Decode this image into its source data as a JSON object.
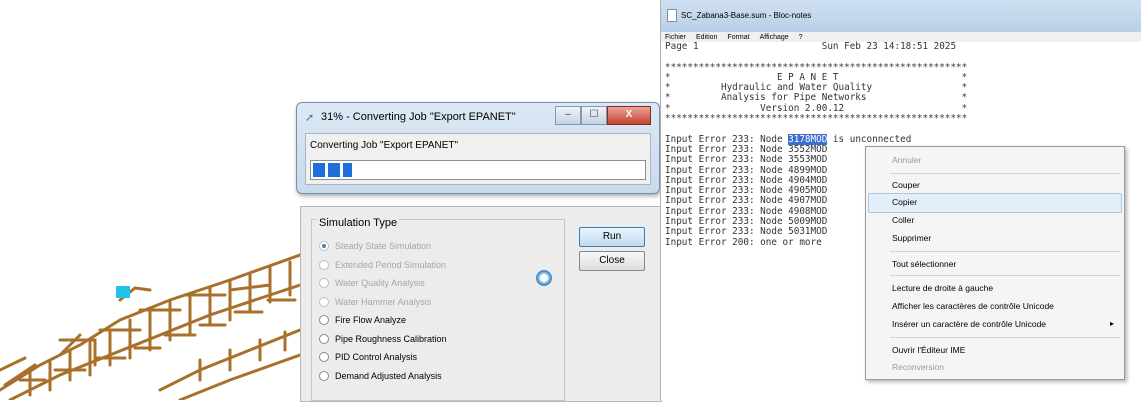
{
  "progress": {
    "title": "31% - Converting Job \"Export EPANET\"",
    "label": "Converting Job \"Export EPANET\"",
    "percent": 31,
    "min_label": "–",
    "max_label": "☐",
    "close_label": "X"
  },
  "simulation": {
    "group_title": "Simulation Type",
    "options": [
      {
        "label": "Steady State Simulation",
        "enabled": false,
        "selected": true
      },
      {
        "label": "Extended Period Simulation",
        "enabled": false,
        "selected": false
      },
      {
        "label": "Water Quality Analysis",
        "enabled": false,
        "selected": false
      },
      {
        "label": "Water Hammer Analysis",
        "enabled": false,
        "selected": false
      },
      {
        "label": "Fire Flow Analyze",
        "enabled": true,
        "selected": false
      },
      {
        "label": "Pipe Roughness Calibration",
        "enabled": true,
        "selected": false
      },
      {
        "label": "PID Control Analysis",
        "enabled": true,
        "selected": false
      },
      {
        "label": "Demand Adjusted Analysis",
        "enabled": true,
        "selected": false
      }
    ],
    "run_label": "Run",
    "close_label": "Close"
  },
  "notepad": {
    "title": "SC_Zabana3-Base.sum - Bloc-notes",
    "menu": [
      "Fichier",
      "Edition",
      "Format",
      "Affichage",
      "?"
    ],
    "lines": [
      "Page 1                      Sun Feb 23 14:18:51 2025",
      "",
      "******************************************************",
      "*                   E P A N E T                      *",
      "*         Hydraulic and Water Quality                *",
      "*         Analysis for Pipe Networks                 *",
      "*                Version 2.00.12                     *",
      "******************************************************",
      "",
      "Input Error 233: Node 3178MOD is unconnected",
      "Input Error 233: Node 3552MOD",
      "Input Error 233: Node 3553MOD",
      "Input Error 233: Node 4899MOD",
      "Input Error 233: Node 4904MOD",
      "Input Error 233: Node 4905MOD",
      "Input Error 233: Node 4907MOD",
      "Input Error 233: Node 4908MOD",
      "Input Error 233: Node 5009MOD",
      "Input Error 233: Node 5031MOD",
      "Input Error 200: one or more"
    ],
    "selected_text": "3178MOD"
  },
  "context_menu": {
    "items": [
      {
        "label": "Annuler",
        "enabled": false
      },
      {
        "label": "Couper",
        "enabled": true
      },
      {
        "label": "Copier",
        "enabled": true,
        "hover": true
      },
      {
        "label": "Coller",
        "enabled": true
      },
      {
        "label": "Supprimer",
        "enabled": true
      },
      {
        "label": "Tout sélectionner",
        "enabled": true
      },
      {
        "label": "Lecture de droite à gauche",
        "enabled": true
      },
      {
        "label": "Afficher les caractères de contrôle Unicode",
        "enabled": true
      },
      {
        "label": "Insérer un caractère de contrôle Unicode",
        "enabled": true,
        "submenu": true
      },
      {
        "label": "Ouvrir l'Éditeur IME",
        "enabled": true
      },
      {
        "label": "Reconversion",
        "enabled": false
      }
    ],
    "submenu_arrow": "▸"
  },
  "colors": {
    "map_pipes": "#a8702a",
    "map_node": "#1ec3e8",
    "progress_fill": "#1e6fdc",
    "selection": "#3b6fd0"
  }
}
